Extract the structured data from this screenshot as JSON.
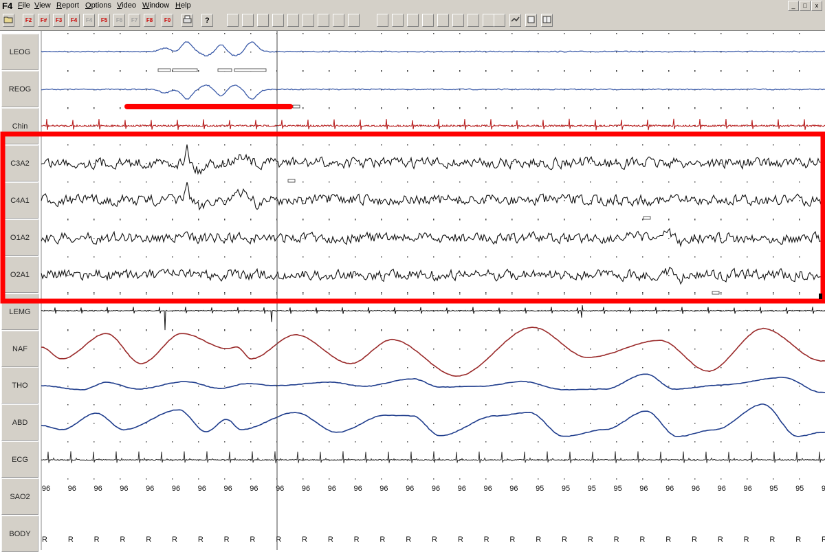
{
  "app": {
    "logo": "F4"
  },
  "menu": [
    "File",
    "View",
    "Report",
    "Options",
    "Video",
    "Window",
    "Help"
  ],
  "window_controls": [
    "_",
    "□",
    "x"
  ],
  "toolbar": {
    "fkeys": [
      "F2",
      "F#",
      "F3",
      "F4",
      "F4",
      "F5",
      "F6",
      "F7",
      "F8",
      "F0"
    ]
  },
  "channels": [
    {
      "name": "LEOG",
      "kind": "eog",
      "color": "#3a5aa8"
    },
    {
      "name": "REOG",
      "kind": "eog",
      "color": "#3a5aa8"
    },
    {
      "name": "Chin",
      "kind": "emg",
      "color": "#b82020"
    },
    {
      "name": "C3A2",
      "kind": "eeg",
      "color": "#111111"
    },
    {
      "name": "C4A1",
      "kind": "eeg",
      "color": "#111111"
    },
    {
      "name": "O1A2",
      "kind": "eeg",
      "color": "#111111"
    },
    {
      "name": "O2A1",
      "kind": "eeg",
      "color": "#111111"
    },
    {
      "name": "LEMG",
      "kind": "lemg",
      "color": "#111111"
    },
    {
      "name": "NAF",
      "kind": "resp",
      "color": "#9a2a2a"
    },
    {
      "name": "THO",
      "kind": "resp",
      "color": "#1e3c8c"
    },
    {
      "name": "ABD",
      "kind": "resp",
      "color": "#1e3c8c"
    },
    {
      "name": "ECG",
      "kind": "ecg",
      "color": "#333333"
    },
    {
      "name": "SAO2",
      "kind": "text",
      "color": "#111111"
    },
    {
      "name": "BODY",
      "kind": "text",
      "color": "#111111"
    }
  ],
  "sao2_values": [
    "96",
    "96",
    "96",
    "96",
    "96",
    "96",
    "96",
    "96",
    "96",
    "96",
    "96",
    "96",
    "96",
    "96",
    "96",
    "96",
    "96",
    "96",
    "96",
    "95",
    "95",
    "95",
    "95",
    "96",
    "96",
    "96",
    "96",
    "96",
    "95",
    "95",
    "95"
  ],
  "body_values": [
    "R",
    "R",
    "R",
    "R",
    "R",
    "R",
    "R",
    "R",
    "R",
    "R",
    "R",
    "R",
    "R",
    "R",
    "R",
    "R",
    "R",
    "R",
    "R",
    "R",
    "R",
    "R",
    "R",
    "R",
    "R",
    "R",
    "R",
    "R",
    "R",
    "R",
    "R"
  ],
  "annotation_colors": {
    "highlight": "#ff0000",
    "cursor": "#444444"
  }
}
